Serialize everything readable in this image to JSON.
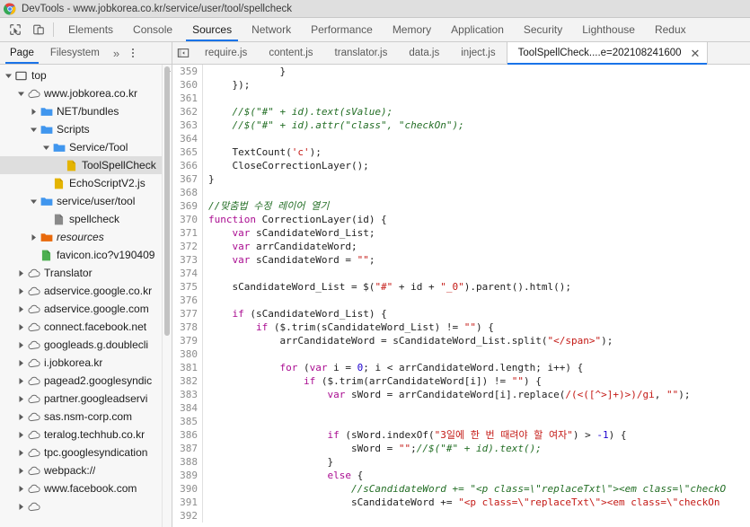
{
  "window": {
    "title": "DevTools - www.jobkorea.co.kr/service/user/tool/spellcheck",
    "app_icon": "chrome-logo-icon"
  },
  "devtools_toolbar": {
    "inspect_icon": "inspect-element-icon",
    "device_toolbar_icon": "device-toggle-icon",
    "tabs": [
      {
        "label": "Elements",
        "active": false
      },
      {
        "label": "Console",
        "active": false
      },
      {
        "label": "Sources",
        "active": true
      },
      {
        "label": "Network",
        "active": false
      },
      {
        "label": "Performance",
        "active": false
      },
      {
        "label": "Memory",
        "active": false
      },
      {
        "label": "Application",
        "active": false
      },
      {
        "label": "Security",
        "active": false
      },
      {
        "label": "Lighthouse",
        "active": false
      },
      {
        "label": "Redux",
        "active": false
      }
    ]
  },
  "navigator": {
    "tabs": [
      {
        "label": "Page",
        "active": true
      },
      {
        "label": "Filesystem",
        "active": false
      }
    ],
    "more_label": "»",
    "kebab_icon": "more-options-icon",
    "tree": [
      {
        "label": "top",
        "indent": 0,
        "twisty": "down",
        "icon": "frame-icon",
        "selected": false,
        "italic": false
      },
      {
        "label": "www.jobkorea.co.kr",
        "indent": 1,
        "twisty": "down",
        "icon": "cloud-icon",
        "selected": false,
        "italic": false
      },
      {
        "label": "NET/bundles",
        "indent": 2,
        "twisty": "right",
        "icon": "folder-blue-icon",
        "selected": false,
        "italic": false
      },
      {
        "label": "Scripts",
        "indent": 2,
        "twisty": "down",
        "icon": "folder-blue-icon",
        "selected": false,
        "italic": false
      },
      {
        "label": "Service/Tool",
        "indent": 3,
        "twisty": "down",
        "icon": "folder-blue-icon",
        "selected": false,
        "italic": false
      },
      {
        "label": "ToolSpellCheck",
        "indent": 4,
        "twisty": "none",
        "icon": "file-js-icon",
        "selected": true,
        "italic": false
      },
      {
        "label": "EchoScriptV2.js",
        "indent": 3,
        "twisty": "none",
        "icon": "file-js-icon",
        "selected": false,
        "italic": false
      },
      {
        "label": "service/user/tool",
        "indent": 2,
        "twisty": "down",
        "icon": "folder-blue-icon",
        "selected": false,
        "italic": false
      },
      {
        "label": "spellcheck",
        "indent": 3,
        "twisty": "none",
        "icon": "file-doc-icon",
        "selected": false,
        "italic": false
      },
      {
        "label": "resources",
        "indent": 2,
        "twisty": "right",
        "icon": "folder-orange-icon",
        "selected": false,
        "italic": true
      },
      {
        "label": "favicon.ico?v190409",
        "indent": 2,
        "twisty": "none",
        "icon": "file-img-icon",
        "selected": false,
        "italic": false
      },
      {
        "label": "Translator",
        "indent": 1,
        "twisty": "right",
        "icon": "cloud-icon",
        "selected": false,
        "italic": false
      },
      {
        "label": "adservice.google.co.kr",
        "indent": 1,
        "twisty": "right",
        "icon": "cloud-icon",
        "selected": false,
        "italic": false
      },
      {
        "label": "adservice.google.com",
        "indent": 1,
        "twisty": "right",
        "icon": "cloud-icon",
        "selected": false,
        "italic": false
      },
      {
        "label": "connect.facebook.net",
        "indent": 1,
        "twisty": "right",
        "icon": "cloud-icon",
        "selected": false,
        "italic": false
      },
      {
        "label": "googleads.g.doublecli",
        "indent": 1,
        "twisty": "right",
        "icon": "cloud-icon",
        "selected": false,
        "italic": false
      },
      {
        "label": "i.jobkorea.kr",
        "indent": 1,
        "twisty": "right",
        "icon": "cloud-icon",
        "selected": false,
        "italic": false
      },
      {
        "label": "pagead2.googlesyndic",
        "indent": 1,
        "twisty": "right",
        "icon": "cloud-icon",
        "selected": false,
        "italic": false
      },
      {
        "label": "partner.googleadservi",
        "indent": 1,
        "twisty": "right",
        "icon": "cloud-icon",
        "selected": false,
        "italic": false
      },
      {
        "label": "sas.nsm-corp.com",
        "indent": 1,
        "twisty": "right",
        "icon": "cloud-icon",
        "selected": false,
        "italic": false
      },
      {
        "label": "teralog.techhub.co.kr",
        "indent": 1,
        "twisty": "right",
        "icon": "cloud-icon",
        "selected": false,
        "italic": false
      },
      {
        "label": "tpc.googlesyndication",
        "indent": 1,
        "twisty": "right",
        "icon": "cloud-icon",
        "selected": false,
        "italic": false
      },
      {
        "label": "webpack://",
        "indent": 1,
        "twisty": "right",
        "icon": "cloud-icon",
        "selected": false,
        "italic": false
      },
      {
        "label": "www.facebook.com",
        "indent": 1,
        "twisty": "right",
        "icon": "cloud-icon",
        "selected": false,
        "italic": false
      },
      {
        "label": "",
        "indent": 1,
        "twisty": "right",
        "icon": "cloud-icon",
        "selected": false,
        "italic": false
      }
    ]
  },
  "editor": {
    "panel_toggle_icon": "show-navigator-icon",
    "tabs": [
      {
        "label": "require.js",
        "active": false,
        "closable": false
      },
      {
        "label": "content.js",
        "active": false,
        "closable": false
      },
      {
        "label": "translator.js",
        "active": false,
        "closable": false
      },
      {
        "label": "data.js",
        "active": false,
        "closable": false
      },
      {
        "label": "inject.js",
        "active": false,
        "closable": false
      },
      {
        "label": "ToolSpellCheck....e=202108241600",
        "active": true,
        "closable": true
      }
    ],
    "close_icon": "close-tab-icon",
    "first_line_number": 359,
    "lines": [
      {
        "n": 359,
        "tokens": [
          {
            "t": "pln",
            "v": "            }"
          }
        ]
      },
      {
        "n": 360,
        "tokens": [
          {
            "t": "pln",
            "v": "    });"
          }
        ]
      },
      {
        "n": 361,
        "tokens": [
          {
            "t": "pln",
            "v": ""
          }
        ]
      },
      {
        "n": 362,
        "tokens": [
          {
            "t": "cmt",
            "v": "    //$(\"#\" + id).text(sValue);"
          }
        ]
      },
      {
        "n": 363,
        "tokens": [
          {
            "t": "cmt",
            "v": "    //$(\"#\" + id).attr(\"class\", \"checkOn\");"
          }
        ]
      },
      {
        "n": 364,
        "tokens": [
          {
            "t": "pln",
            "v": ""
          }
        ]
      },
      {
        "n": 365,
        "tokens": [
          {
            "t": "pln",
            "v": "    TextCount("
          },
          {
            "t": "str",
            "v": "'c'"
          },
          {
            "t": "pln",
            "v": ");"
          }
        ]
      },
      {
        "n": 366,
        "tokens": [
          {
            "t": "pln",
            "v": "    CloseCorrectionLayer();"
          }
        ]
      },
      {
        "n": 367,
        "tokens": [
          {
            "t": "pln",
            "v": "}"
          }
        ]
      },
      {
        "n": 368,
        "tokens": [
          {
            "t": "pln",
            "v": ""
          }
        ]
      },
      {
        "n": 369,
        "tokens": [
          {
            "t": "cmt",
            "v": "//맞춤법 수정 레이어 열기"
          }
        ]
      },
      {
        "n": 370,
        "tokens": [
          {
            "t": "kw",
            "v": "function"
          },
          {
            "t": "pln",
            "v": " CorrectionLayer(id) {"
          }
        ]
      },
      {
        "n": 371,
        "tokens": [
          {
            "t": "pln",
            "v": "    "
          },
          {
            "t": "kw",
            "v": "var"
          },
          {
            "t": "pln",
            "v": " sCandidateWord_List;"
          }
        ]
      },
      {
        "n": 372,
        "tokens": [
          {
            "t": "pln",
            "v": "    "
          },
          {
            "t": "kw",
            "v": "var"
          },
          {
            "t": "pln",
            "v": " arrCandidateWord;"
          }
        ]
      },
      {
        "n": 373,
        "tokens": [
          {
            "t": "pln",
            "v": "    "
          },
          {
            "t": "kw",
            "v": "var"
          },
          {
            "t": "pln",
            "v": " sCandidateWord = "
          },
          {
            "t": "str",
            "v": "\"\""
          },
          {
            "t": "pln",
            "v": ";"
          }
        ]
      },
      {
        "n": 374,
        "tokens": [
          {
            "t": "pln",
            "v": ""
          }
        ]
      },
      {
        "n": 375,
        "tokens": [
          {
            "t": "pln",
            "v": "    sCandidateWord_List = $("
          },
          {
            "t": "str",
            "v": "\"#\""
          },
          {
            "t": "pln",
            "v": " + id + "
          },
          {
            "t": "str",
            "v": "\"_0\""
          },
          {
            "t": "pln",
            "v": ").parent().html();"
          }
        ]
      },
      {
        "n": 376,
        "tokens": [
          {
            "t": "pln",
            "v": ""
          }
        ]
      },
      {
        "n": 377,
        "tokens": [
          {
            "t": "pln",
            "v": "    "
          },
          {
            "t": "kw",
            "v": "if"
          },
          {
            "t": "pln",
            "v": " (sCandidateWord_List) {"
          }
        ]
      },
      {
        "n": 378,
        "tokens": [
          {
            "t": "pln",
            "v": "        "
          },
          {
            "t": "kw",
            "v": "if"
          },
          {
            "t": "pln",
            "v": " ($.trim(sCandidateWord_List) != "
          },
          {
            "t": "str",
            "v": "\"\""
          },
          {
            "t": "pln",
            "v": ") {"
          }
        ]
      },
      {
        "n": 379,
        "tokens": [
          {
            "t": "pln",
            "v": "            arrCandidateWord = sCandidateWord_List.split("
          },
          {
            "t": "str",
            "v": "\"</span>\""
          },
          {
            "t": "pln",
            "v": ");"
          }
        ]
      },
      {
        "n": 380,
        "tokens": [
          {
            "t": "pln",
            "v": ""
          }
        ]
      },
      {
        "n": 381,
        "tokens": [
          {
            "t": "pln",
            "v": "            "
          },
          {
            "t": "kw",
            "v": "for"
          },
          {
            "t": "pln",
            "v": " ("
          },
          {
            "t": "kw",
            "v": "var"
          },
          {
            "t": "pln",
            "v": " i = "
          },
          {
            "t": "num",
            "v": "0"
          },
          {
            "t": "pln",
            "v": "; i < arrCandidateWord.length; i++) {"
          }
        ]
      },
      {
        "n": 382,
        "tokens": [
          {
            "t": "pln",
            "v": "                "
          },
          {
            "t": "kw",
            "v": "if"
          },
          {
            "t": "pln",
            "v": " ($.trim(arrCandidateWord[i]) != "
          },
          {
            "t": "str",
            "v": "\"\""
          },
          {
            "t": "pln",
            "v": ") {"
          }
        ]
      },
      {
        "n": 383,
        "tokens": [
          {
            "t": "pln",
            "v": "                    "
          },
          {
            "t": "kw",
            "v": "var"
          },
          {
            "t": "pln",
            "v": " sWord = arrCandidateWord[i].replace("
          },
          {
            "t": "str",
            "v": "/(<([^>]+)>)/gi"
          },
          {
            "t": "pln",
            "v": ", "
          },
          {
            "t": "str",
            "v": "\"\""
          },
          {
            "t": "pln",
            "v": ");"
          }
        ]
      },
      {
        "n": 384,
        "tokens": [
          {
            "t": "pln",
            "v": ""
          }
        ]
      },
      {
        "n": 385,
        "tokens": [
          {
            "t": "pln",
            "v": ""
          }
        ]
      },
      {
        "n": 386,
        "tokens": [
          {
            "t": "pln",
            "v": "                    "
          },
          {
            "t": "kw",
            "v": "if"
          },
          {
            "t": "pln",
            "v": " (sWord.indexOf("
          },
          {
            "t": "str",
            "v": "\"3일에 한 번 때려야 할 여자\""
          },
          {
            "t": "pln",
            "v": ") > "
          },
          {
            "t": "num",
            "v": "-1"
          },
          {
            "t": "pln",
            "v": ") {"
          }
        ]
      },
      {
        "n": 387,
        "tokens": [
          {
            "t": "pln",
            "v": "                        sWord = "
          },
          {
            "t": "str",
            "v": "\"\""
          },
          {
            "t": "pln",
            "v": ";"
          },
          {
            "t": "cmt",
            "v": "//$(\"#\" + id).text();"
          }
        ]
      },
      {
        "n": 388,
        "tokens": [
          {
            "t": "pln",
            "v": "                    }"
          }
        ]
      },
      {
        "n": 389,
        "tokens": [
          {
            "t": "pln",
            "v": "                    "
          },
          {
            "t": "kw",
            "v": "else"
          },
          {
            "t": "pln",
            "v": " {"
          }
        ]
      },
      {
        "n": 390,
        "tokens": [
          {
            "t": "cmt",
            "v": "                        //sCandidateWord += \"<p class=\\\"replaceTxt\\\"><em class=\\\"checkO"
          }
        ]
      },
      {
        "n": 391,
        "tokens": [
          {
            "t": "pln",
            "v": "                        sCandidateWord += "
          },
          {
            "t": "str",
            "v": "\"<p class=\\\"replaceTxt\\\"><em class=\\\"checkOn"
          }
        ]
      },
      {
        "n": 392,
        "tokens": [
          {
            "t": "pln",
            "v": ""
          }
        ]
      }
    ]
  }
}
